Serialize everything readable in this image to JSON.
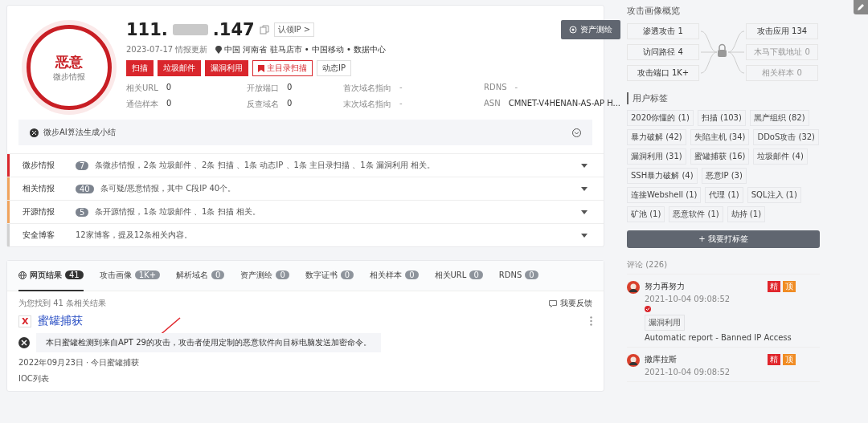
{
  "header": {
    "verdict": "恶意",
    "verdict_source": "微步情报",
    "ip_start": "111.",
    "ip_end": ".147",
    "claim": "认领IP",
    "claim_arrow": ">",
    "updated": "2023-07-17 情报更新",
    "location": "中国 河南省 驻马店市 • 中国移动 • 数据中心",
    "asset_button": "资产测绘",
    "tags": [
      {
        "label": "扫描",
        "kind": "solid"
      },
      {
        "label": "垃圾邮件",
        "kind": "solid"
      },
      {
        "label": "漏洞利用",
        "kind": "solid"
      },
      {
        "label": "主目录扫描",
        "kind": "flagged"
      },
      {
        "label": "动态IP",
        "kind": "plain"
      }
    ],
    "facts": [
      {
        "label": "相关URL",
        "value": "0"
      },
      {
        "label": "开放端口",
        "value": "0"
      },
      {
        "label": "首次域名指向",
        "value": "-"
      },
      {
        "label": "RDNS",
        "value": "-"
      },
      {
        "label": "通信样本",
        "value": "0"
      },
      {
        "label": "反查域名",
        "value": "0"
      },
      {
        "label": "末次域名指向",
        "value": "-"
      },
      {
        "label": "ASN",
        "value": "CMNET-V4HENAN-AS-AP H..."
      }
    ]
  },
  "ai_summary": {
    "label": "微步AI算法生成小结",
    "expanded": false
  },
  "intel_rows": [
    {
      "title": "微步情报",
      "count": "7",
      "text": "条微步情报，2条 垃圾邮件 、2条 扫描 、1条 动态IP 、1条 主目录扫描 、1条 漏洞利用 相关。",
      "color": "#d9262c"
    },
    {
      "title": "相关情报",
      "count": "40",
      "text": "条可疑/恶意情报，其中 C段IP 40个。",
      "color": "#f0a35c"
    },
    {
      "title": "开源情报",
      "count": "5",
      "text": "条开源情报，1条 垃圾邮件 、1条 扫描 相关。",
      "color": "#f0a35c"
    },
    {
      "title": "安全博客",
      "text": "12家博客，提及12条相关内容。",
      "color": "#d0d0d0"
    }
  ],
  "tabs": [
    {
      "label": "网页结果",
      "count": "41",
      "selected": true
    },
    {
      "label": "攻击画像",
      "count": "1K+",
      "selected": false
    },
    {
      "label": "解析域名",
      "count": "0",
      "selected": false
    },
    {
      "label": "资产测绘",
      "count": "0",
      "selected": false
    },
    {
      "label": "数字证书",
      "count": "0",
      "selected": false
    },
    {
      "label": "相关样本",
      "count": "0",
      "selected": false
    },
    {
      "label": "相关URL",
      "count": "0",
      "selected": false
    },
    {
      "label": "RDNS",
      "count": "0",
      "selected": false
    }
  ],
  "results": {
    "found": "为您找到 41 条相关结果",
    "feedback": "我要反馈",
    "item": {
      "source_mark": "X",
      "title": "蜜罐捕获",
      "summary": "本日蜜罐检测到来自APT 29的攻击，攻击者使用定制的恶意软件向目标电脑发送加密命令。",
      "date_line": "2022年09月23日 · 今日蜜罐捕获",
      "cut_line": "IOC列表"
    }
  },
  "profile": {
    "title": "攻击画像概览",
    "left": [
      {
        "label": "渗透攻击 1",
        "disabled": false
      },
      {
        "label": "访问路径 4",
        "disabled": false
      },
      {
        "label": "攻击端口 1K+",
        "disabled": false
      }
    ],
    "right": [
      {
        "label": "攻击应用 134",
        "disabled": false
      },
      {
        "label": "木马下载地址 0",
        "disabled": true
      },
      {
        "label": "相关样本 0",
        "disabled": true
      }
    ]
  },
  "user_tags": {
    "title": "用户标签",
    "tags": [
      "2020你懂的 (1)",
      "扫描 (103)",
      "黑产组织 (82)",
      "暴力破解 (42)",
      "失陷主机 (34)",
      "DDoS攻击 (32)",
      "漏洞利用 (31)",
      "蜜罐捕获 (16)",
      "垃圾邮件 (4)",
      "SSH暴力破解 (4)",
      "恶意IP (3)",
      "连接Webshell (1)",
      "代理 (1)",
      "SQL注入 (1)",
      "矿池 (1)",
      "恶意软件 (1)",
      "劫持 (1)"
    ],
    "button": "+ 我要打标签"
  },
  "comments": {
    "title": "评论 (226)",
    "items": [
      {
        "user": "努力再努力",
        "time": "2021-10-04 09:08:52",
        "badges": [
          {
            "label": "精",
            "color": "#e0262c"
          },
          {
            "label": "顶",
            "color": "#f08c24"
          }
        ],
        "tag": "漏洞利用",
        "text": "Automatic report - Banned IP Access"
      },
      {
        "user": "撒库拉斯",
        "time": "2021-10-04 09:08:52",
        "badges": [
          {
            "label": "精",
            "color": "#e0262c"
          },
          {
            "label": "顶",
            "color": "#f08c24"
          }
        ]
      }
    ]
  }
}
